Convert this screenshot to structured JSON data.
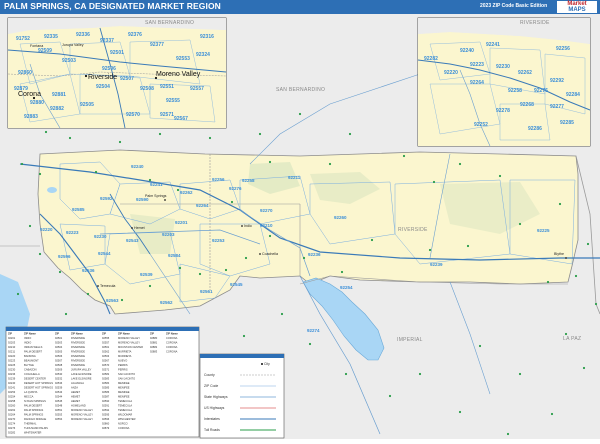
{
  "header": {
    "title": "PALM SPRINGS, CA DESIGNATED MARKET REGION",
    "edition": "2023 ZIP Code Basic Edition",
    "logo_top": "Market",
    "logo_bottom": "MAPS"
  },
  "map": {
    "counties": [
      "SAN BERNARDINO",
      "RIVERSIDE",
      "IMPERIAL",
      "LA PAZ",
      "SAN BERNARDINO",
      "RIVERSIDE"
    ],
    "inset_left_cities": [
      "Riverside",
      "Moreno Valley",
      "Corona",
      "Fontana",
      "Jurupa Valley"
    ],
    "inset_left_zips": [
      "92509",
      "92503",
      "92506",
      "92507",
      "92504",
      "92508",
      "92551",
      "92553",
      "92557",
      "92555",
      "92571",
      "92567",
      "92570",
      "92335",
      "92336",
      "92337",
      "92880",
      "92882",
      "92883",
      "92879",
      "92881",
      "92860",
      "92501",
      "92505",
      "91752",
      "92377",
      "92376",
      "92316",
      "92324"
    ],
    "inset_right_zips": [
      "92241",
      "92240",
      "92256",
      "92282",
      "92220",
      "92223",
      "92230",
      "92262",
      "92264",
      "92258",
      "92276",
      "92292",
      "92284",
      "92268",
      "92277",
      "92278",
      "92252",
      "92285",
      "92286"
    ],
    "main_zips": [
      "92240",
      "92241",
      "92256",
      "92262",
      "92264",
      "92258",
      "92276",
      "92270",
      "92211",
      "92260",
      "92253",
      "92210",
      "92201",
      "92203",
      "92236",
      "92274",
      "92254",
      "92225",
      "92239",
      "92274",
      "92282",
      "92220",
      "92223",
      "92230",
      "92543",
      "92544",
      "92545",
      "92561",
      "92539",
      "92536",
      "92563",
      "92562",
      "92596",
      "92590",
      "92592",
      "92584",
      "92585",
      "92587",
      "92595",
      "92530",
      "92532",
      "92570",
      "92548"
    ],
    "main_cities": [
      "Indio",
      "Palm Springs",
      "Hemet",
      "Temecula",
      "Coachella",
      "Blythe"
    ]
  },
  "legend": {
    "items": [
      "City",
      "County",
      "ZIP Code",
      "State Highways",
      "US Highways",
      "Interstates",
      "Toll Roads"
    ]
  },
  "zip_table": {
    "headers": [
      "ZIP",
      "ZIP Name",
      "ZIP",
      "ZIP Name",
      "ZIP",
      "ZIP Name",
      "ZIP",
      "ZIP Name"
    ],
    "rows": [
      [
        "92201",
        "INDIO",
        "92501",
        "RIVERSIDE",
        "92555",
        "MORENO VALLEY",
        "92880",
        "CORONA"
      ],
      [
        "92203",
        "INDIO",
        "92503",
        "RIVERSIDE",
        "92557",
        "MORENO VALLEY",
        "92881",
        "CORONA"
      ],
      [
        "92210",
        "INDIAN WELLS",
        "92504",
        "RIVERSIDE",
        "92561",
        "MOUNTAIN CENTER",
        "92882",
        "CORONA"
      ],
      [
        "92211",
        "PALM DESERT",
        "92505",
        "RIVERSIDE",
        "92562",
        "MURRIETA",
        "92883",
        "CORONA"
      ],
      [
        "92220",
        "BANNING",
        "92506",
        "RIVERSIDE",
        "92563",
        "MURRIETA",
        "",
        ""
      ],
      [
        "92223",
        "BEAUMONT",
        "92507",
        "RIVERSIDE",
        "92567",
        "NUEVO",
        "",
        ""
      ],
      [
        "92225",
        "BLYTHE",
        "92508",
        "RIVERSIDE",
        "92570",
        "PERRIS",
        "",
        ""
      ],
      [
        "92230",
        "CABAZON",
        "92509",
        "JURUPA VALLEY",
        "92571",
        "PERRIS",
        "",
        ""
      ],
      [
        "92236",
        "COACHELLA",
        "92530",
        "LAKE ELSINORE",
        "92582",
        "SAN JACINTO",
        "",
        ""
      ],
      [
        "92239",
        "DESERT CENTER",
        "92532",
        "LAKE ELSINORE",
        "92583",
        "SAN JACINTO",
        "",
        ""
      ],
      [
        "92240",
        "DESERT HOT SPRINGS",
        "92536",
        "AGUANGA",
        "92584",
        "MENIFEE",
        "",
        ""
      ],
      [
        "92241",
        "DESERT HOT SPRINGS",
        "92539",
        "ANZA",
        "92585",
        "MENIFEE",
        "",
        ""
      ],
      [
        "92253",
        "LA QUINTA",
        "92543",
        "HEMET",
        "92586",
        "MENIFEE",
        "",
        ""
      ],
      [
        "92254",
        "MECCA",
        "92544",
        "HEMET",
        "92587",
        "MENIFEE",
        "",
        ""
      ],
      [
        "92258",
        "N PALM SPRINGS",
        "92545",
        "HEMET",
        "92590",
        "TEMECULA",
        "",
        ""
      ],
      [
        "92260",
        "PALM DESERT",
        "92548",
        "HOMELAND",
        "92591",
        "TEMECULA",
        "",
        ""
      ],
      [
        "92262",
        "PALM SPRINGS",
        "92551",
        "MORENO VALLEY",
        "92592",
        "TEMECULA",
        "",
        ""
      ],
      [
        "92264",
        "PALM SPRINGS",
        "92553",
        "MORENO VALLEY",
        "92595",
        "WILDOMAR",
        "",
        ""
      ],
      [
        "92270",
        "RANCHO MIRAGE",
        "92554",
        "MORENO VALLEY",
        "92596",
        "WINCHESTER",
        "",
        ""
      ],
      [
        "92274",
        "THERMAL",
        "",
        "",
        "92860",
        "NORCO",
        "",
        ""
      ],
      [
        "92276",
        "THOUSAND PALMS",
        "",
        "",
        "92879",
        "CORONA",
        "",
        ""
      ],
      [
        "92282",
        "WHITEWATER",
        "",
        "",
        "",
        "",
        "",
        ""
      ]
    ]
  },
  "colors": {
    "title_bar": "#2d6fb5",
    "land_in_region": "#fbf6cf",
    "land_outside": "#ececec",
    "water": "#a9d6f5",
    "zip_label": "#3a8ed8",
    "county_line": "#9a9a9a",
    "interstate": "#3a7ab8",
    "highway": "#6a9fd0"
  }
}
